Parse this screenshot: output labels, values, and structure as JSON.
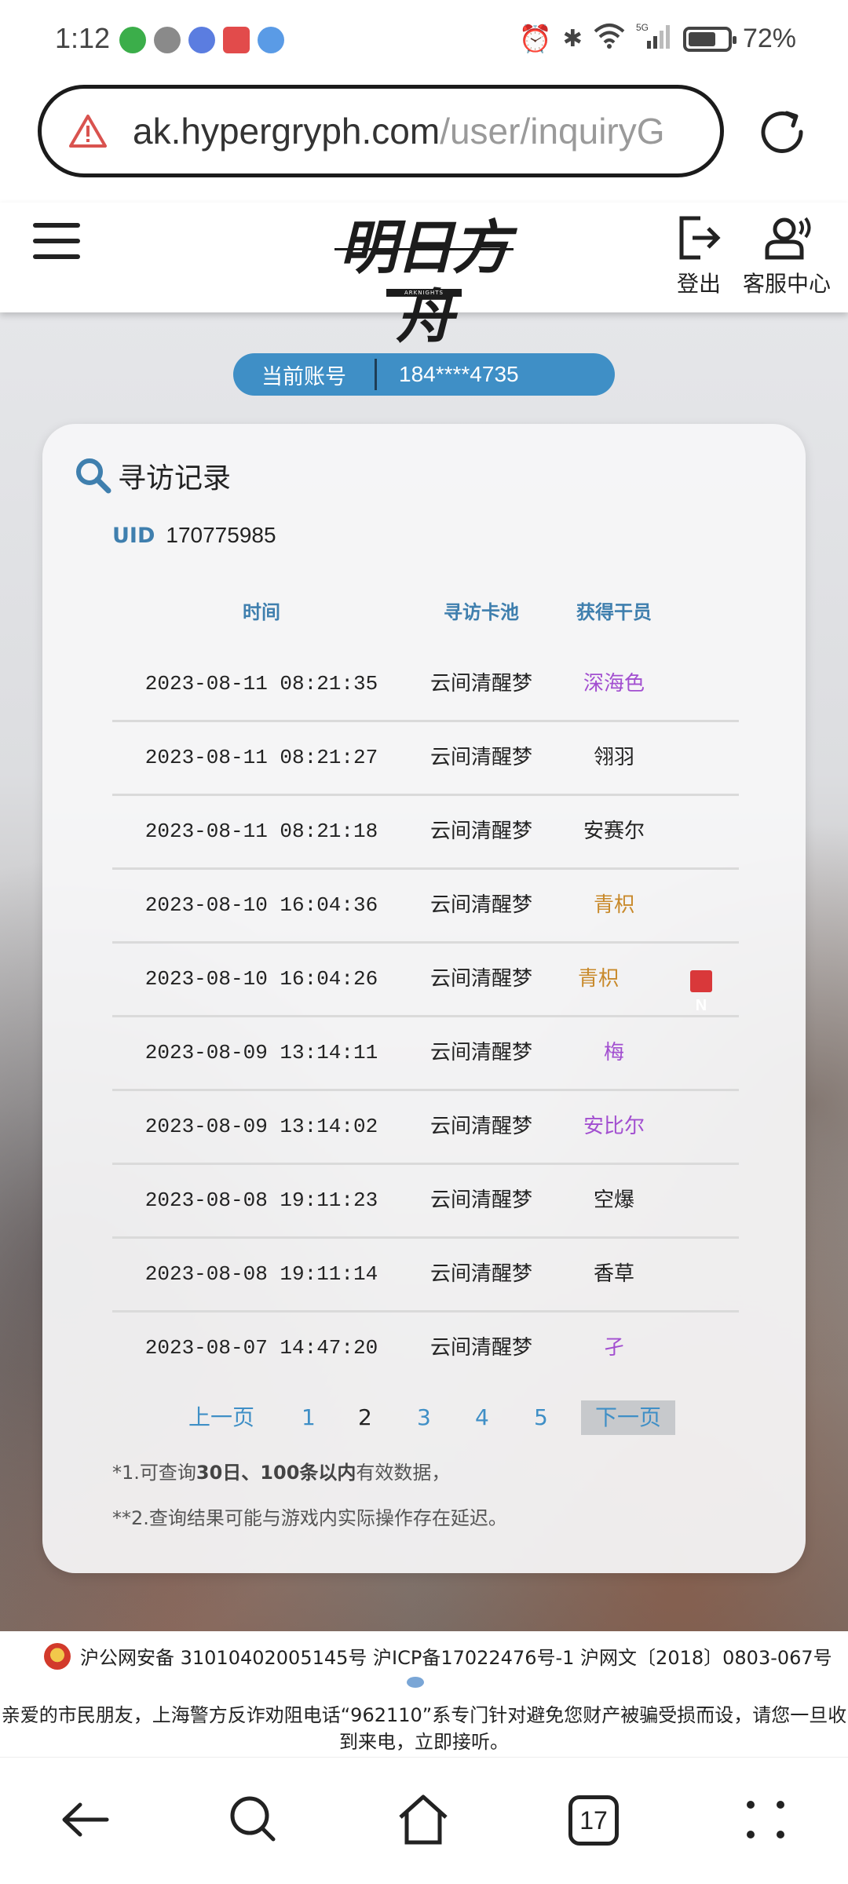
{
  "status_bar": {
    "time": "1:12",
    "battery_percent": "72%",
    "battery_level": 0.72,
    "signal_label": "5G",
    "wifi_label": "6"
  },
  "browser": {
    "url_host": "ak.hypergryph.com",
    "url_path": "/user/inquiryG",
    "tab_count": "17"
  },
  "header": {
    "logo_text": "明日方舟",
    "logo_sub": "ARKNIGHTS",
    "logout_label": "登出",
    "support_label": "客服中心"
  },
  "account": {
    "label": "当前账号",
    "value": "184****4735"
  },
  "card": {
    "title": "寻访记录",
    "uid_label": "UID",
    "uid_value": "170775985",
    "columns": [
      "时间",
      "寻访卡池",
      "获得干员"
    ],
    "rows": [
      {
        "time": "2023-08-11 08:21:35",
        "pool": "云间清醒梦",
        "operator": "深海色",
        "rarity": "purple",
        "is_new": false
      },
      {
        "time": "2023-08-11 08:21:27",
        "pool": "云间清醒梦",
        "operator": "翎羽",
        "rarity": "normal",
        "is_new": false
      },
      {
        "time": "2023-08-11 08:21:18",
        "pool": "云间清醒梦",
        "operator": "安赛尔",
        "rarity": "normal",
        "is_new": false
      },
      {
        "time": "2023-08-10 16:04:36",
        "pool": "云间清醒梦",
        "operator": "青枳",
        "rarity": "gold",
        "is_new": false
      },
      {
        "time": "2023-08-10 16:04:26",
        "pool": "云间清醒梦",
        "operator": "青枳",
        "rarity": "gold",
        "is_new": true
      },
      {
        "time": "2023-08-09 13:14:11",
        "pool": "云间清醒梦",
        "operator": "梅",
        "rarity": "purple",
        "is_new": false
      },
      {
        "time": "2023-08-09 13:14:02",
        "pool": "云间清醒梦",
        "operator": "安比尔",
        "rarity": "purple",
        "is_new": false
      },
      {
        "time": "2023-08-08 19:11:23",
        "pool": "云间清醒梦",
        "operator": "空爆",
        "rarity": "normal",
        "is_new": false
      },
      {
        "time": "2023-08-08 19:11:14",
        "pool": "云间清醒梦",
        "operator": "香草",
        "rarity": "normal",
        "is_new": false
      },
      {
        "time": "2023-08-07 14:47:20",
        "pool": "云间清醒梦",
        "operator": "孑",
        "rarity": "purple",
        "is_new": false
      }
    ],
    "new_badge": "N",
    "pager": {
      "prev": "上一页",
      "pages": [
        "1",
        "2",
        "3",
        "4",
        "5"
      ],
      "current": "2",
      "next": "下一页"
    },
    "note1_prefix": "*1.可查询",
    "note1_bold": "30日、100条以内",
    "note1_suffix": "有效数据，",
    "note2": "**2.查询结果可能与游戏内实际操作存在延迟。"
  },
  "footer": {
    "line1": "沪公网安备 31010402005145号  沪ICP备17022476号-1  沪网文〔2018〕0803-067号",
    "line2": "亲爱的市民朋友，上海警方反诈劝阻电话“962110”系专门针对避免您财产被骗受损而设，请您一旦收到来电，立即接听。"
  },
  "colors": {
    "accent": "#3f8fc6",
    "header_text": "#3f7fae",
    "rarity_purple": "#a24fd0",
    "rarity_gold": "#c8892a",
    "new_badge": "#d9383a"
  }
}
